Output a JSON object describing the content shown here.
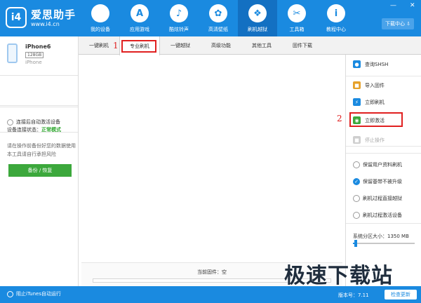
{
  "header": {
    "logo_badge": "i4",
    "logo_text": "爱思助手",
    "logo_url": "www.i4.cn",
    "nav": [
      {
        "label": "我的设备",
        "icon": "apple-icon",
        "glyph": ""
      },
      {
        "label": "应用游戏",
        "icon": "appstore-icon",
        "glyph": "A"
      },
      {
        "label": "酷炫铃声",
        "icon": "bell-icon",
        "glyph": "♪"
      },
      {
        "label": "高清壁纸",
        "icon": "flower-icon",
        "glyph": "✿"
      },
      {
        "label": "刷机越狱",
        "icon": "dropbox-icon",
        "glyph": "❖"
      },
      {
        "label": "工具箱",
        "icon": "tools-icon",
        "glyph": "✂"
      },
      {
        "label": "教程中心",
        "icon": "info-icon",
        "glyph": "i"
      }
    ],
    "active_nav": 4,
    "download_center": "下载中心 ⇩",
    "win_minimize": "—",
    "win_close": "✕"
  },
  "device": {
    "name": "iPhone6",
    "capacity": "128GB",
    "model": "iPhone"
  },
  "left": {
    "status_label": "设备连接状态：",
    "status_value": "正常模式",
    "auto_activate": "连接后自动激活设备",
    "backup_tip": "请在操作前备份好您的数据使用本工具请自行承担风险",
    "backup_button": "备份 / 恢复"
  },
  "tabs": [
    "一键刷机",
    "专业刷机",
    "一键越狱",
    "高级功能",
    "其他工具",
    "固件下载"
  ],
  "active_tab": 1,
  "annotations": {
    "one": "1",
    "two": "2"
  },
  "firmware": {
    "label": "当前固件：空"
  },
  "actions": [
    {
      "label": "查询SHSH",
      "icon": "search-icon",
      "glyph": "●",
      "color": "#1a8ae0"
    },
    {
      "label": "导入固件",
      "icon": "import-icon",
      "glyph": "■",
      "color": "#e6a12a"
    },
    {
      "label": "立即刷机",
      "icon": "flash-icon",
      "glyph": "⚡",
      "color": "#1a8ae0"
    },
    {
      "label": "立即激活",
      "icon": "globe-icon",
      "glyph": "◉",
      "color": "#3ca83c"
    },
    {
      "label": "停止操作",
      "icon": "stop-icon",
      "glyph": "■",
      "color": "#cfcfcf"
    }
  ],
  "options": [
    {
      "label": "保留用户资料刷机",
      "checked": false
    },
    {
      "label": "保留基带不被升级",
      "checked": true
    },
    {
      "label": "刷机过程直接越狱",
      "checked": false
    },
    {
      "label": "刷机过程激活设备",
      "checked": false
    }
  ],
  "system_partition": {
    "label": "系统分区大小：1350 MB",
    "fill": 0.04
  },
  "statusbar": {
    "itunes": "阻止iTunes自动运行",
    "version": "版本号：7.11",
    "update_button": "检查更新"
  },
  "watermark": "极速下载站"
}
